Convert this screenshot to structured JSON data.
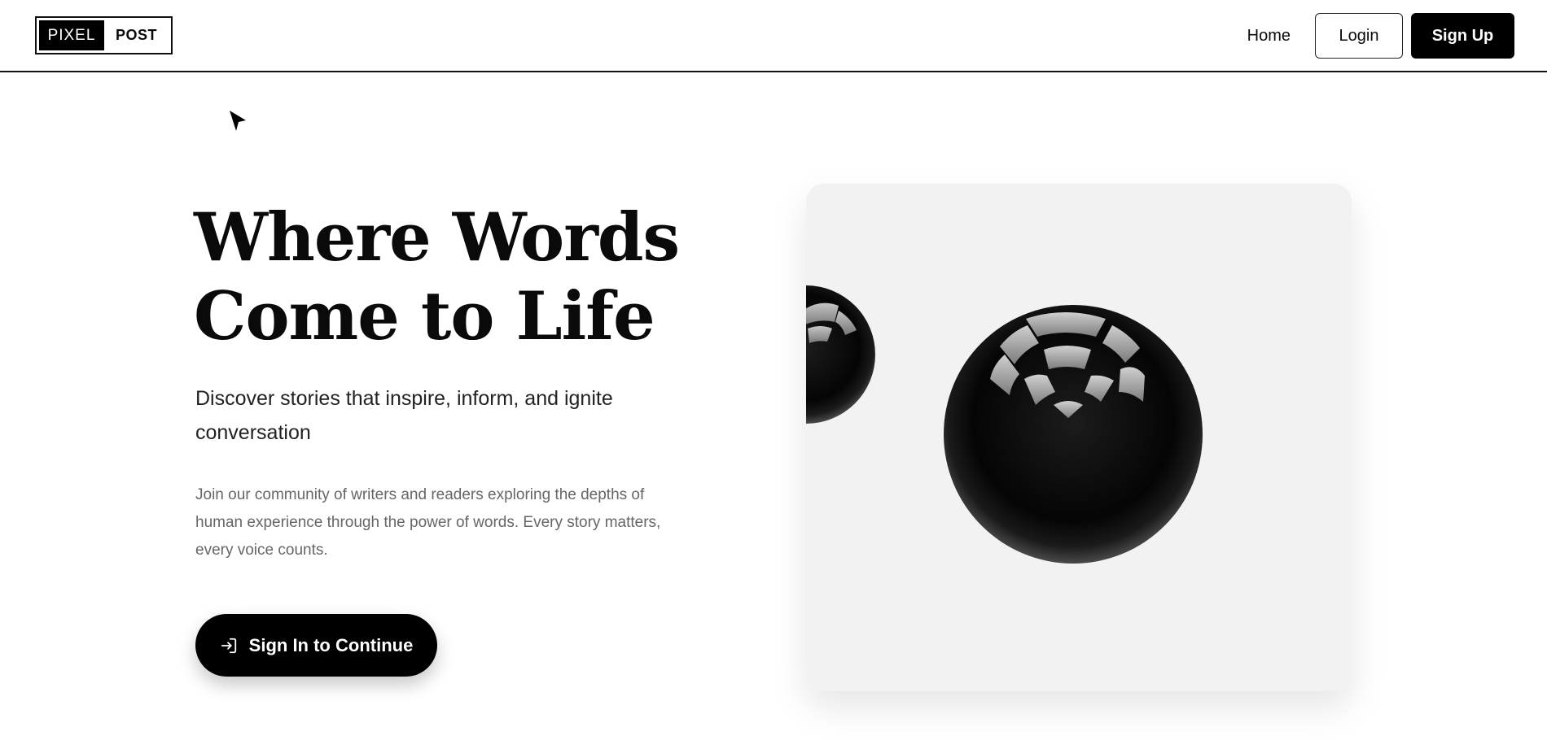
{
  "brand": {
    "logo_left": "PIXEL",
    "logo_right": "POST"
  },
  "nav": {
    "home": "Home",
    "login": "Login",
    "signup": "Sign Up"
  },
  "hero": {
    "title_line1": "Where Words",
    "title_line2": "Come to Life",
    "subtitle": "Discover stories that inspire, inform, and ignite conversation",
    "body": "Join our community of writers and readers exploring the depths of human experience through the power of words. Every story matters, every voice counts.",
    "cta_label": "Sign In to Continue",
    "cta_icon": "login-arrow-icon"
  },
  "illustration": {
    "description_icon": "glossy-spheres-image"
  },
  "colors": {
    "primary": "#000000",
    "card_bg": "#f2f2f2",
    "muted_text": "#666666"
  }
}
